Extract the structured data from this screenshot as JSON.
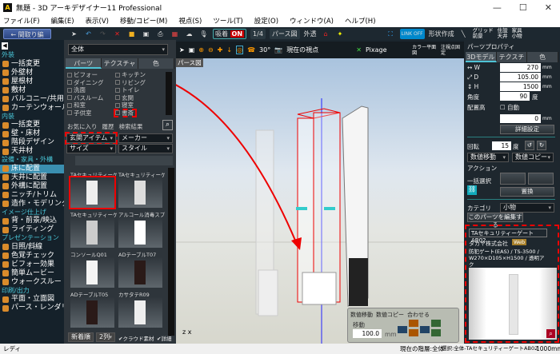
{
  "window": {
    "title": "無題 - 3D アーキデザイナー11 Professional",
    "minimize": "—",
    "maximize": "☐",
    "close": "✕"
  },
  "menu": [
    "ファイル(F)",
    "編集(E)",
    "表示(V)",
    "移動/コピー(M)",
    "視点(S)",
    "ツール(T)",
    "設定(O)",
    "ウィンドウ(A)",
    "ヘルプ(H)"
  ],
  "toolbar": {
    "back": "← 間取り編集へ",
    "snap_label": "吸着",
    "snap_state": "ON",
    "scale": "1/4",
    "view": "パース図",
    "outer": "外透",
    "link": "LINK OFF",
    "shape": "形状作成",
    "grid": "グリッド",
    "foreground": "前景",
    "ceiling": "天井",
    "settings": "住設",
    "furniture": "家具",
    "small": "小物"
  },
  "nav": [
    {
      "h": "外装"
    },
    {
      "t": "一括変更"
    },
    {
      "t": "外壁材"
    },
    {
      "t": "屋根材"
    },
    {
      "t": "敷材"
    },
    {
      "t": "バルコニー/共用廊下"
    },
    {
      "t": "カーテンウォール"
    },
    {
      "h": "内装"
    },
    {
      "t": "一括変更"
    },
    {
      "t": "壁・床材"
    },
    {
      "t": "階段デザイン"
    },
    {
      "t": "天井材"
    },
    {
      "h": "設備・家具・外構"
    },
    {
      "t": "床に配置",
      "sel": true
    },
    {
      "t": "天井に配置"
    },
    {
      "t": "外構に配置"
    },
    {
      "t": "ニッチ/トリム"
    },
    {
      "t": "造作・モデリング"
    },
    {
      "h": "イメージ仕上げ"
    },
    {
      "t": "背・前景/映込"
    },
    {
      "t": "ライティング"
    },
    {
      "h": "プレゼンテーション"
    },
    {
      "t": "日照/斜線"
    },
    {
      "t": "色覚チェック"
    },
    {
      "t": "ビフォー効果"
    },
    {
      "t": "簡単ムービー"
    },
    {
      "t": "ウォークスルー"
    },
    {
      "h": "印刷/出力"
    },
    {
      "t": "平面・立面図"
    },
    {
      "t": "パース・レンダリング"
    }
  ],
  "parts": {
    "scope": "全体",
    "tabs": [
      "パーツ",
      "テクスチャ",
      "色"
    ],
    "rooms_left": [
      "ビフォー",
      "ダイニング",
      "洗面",
      "バスルーム",
      "和室",
      "子供室"
    ],
    "rooms_right": [
      "キッチン",
      "リビング",
      "トイレ",
      "玄関",
      "寝室",
      "書斎"
    ],
    "filters": [
      "お気に入り",
      "履歴",
      "検索結果"
    ],
    "item_type": "玄関アイテム",
    "maker": "メーカー",
    "size": "サイズ",
    "style": "スタイル",
    "items": [
      "TAセキュリティーゲ…",
      "TAセキュリティーゲ…",
      "TAセキュリティーゲ…",
      "アルコール消毒スプ…",
      "コンソールQ01",
      "ADテーブルT07",
      "ADテーブルT05",
      "カサタテR09"
    ],
    "sort": "新着順",
    "cols": "2列",
    "cloud": "クラウド素材",
    "detail": "詳細"
  },
  "viewport": {
    "label": "パース図",
    "angle": "30°",
    "viewpoint": "現在の視点",
    "renderer": "Pixage",
    "color_plan": "カラー平面図",
    "fix_view": "注視点固定",
    "move": {
      "options": [
        "数値移動",
        "数値コピー",
        "合わせる"
      ],
      "label": "移動",
      "value": "100.0",
      "unit": "mm"
    }
  },
  "props": {
    "title": "パーツプロパティ",
    "tabs": [
      "3Dモデル",
      "テクスチャ",
      "色"
    ],
    "w": "270",
    "d": "105.00",
    "h": "1500",
    "unit": "mm",
    "angle_label": "角度",
    "angle": "90",
    "deg": "度",
    "height_label": "配置高",
    "auto": "自動",
    "height": "0",
    "detail": "詳細設定",
    "rotate_label": "回転",
    "rotate": "15",
    "move": "数値移動",
    "copy": "数値コピー",
    "action": "アクション",
    "bulk": "一括選択",
    "replace": "置換",
    "category_label": "カテゴリ",
    "category": "小物",
    "edit": "このパーツを編集する",
    "name": "TAセキュリティーゲートAB02",
    "maker": "タカヤ株式会社",
    "web": "Web",
    "desc": "防犯ゲート(EAS) / TS-3500 / W270×D105×H1500 / 透明アク"
  },
  "status": {
    "left": "レディ",
    "layer": "現在の階層:全体",
    "selection": "選択:全体-TAセキュリティーゲートAB02",
    "scale": "1000mm"
  }
}
